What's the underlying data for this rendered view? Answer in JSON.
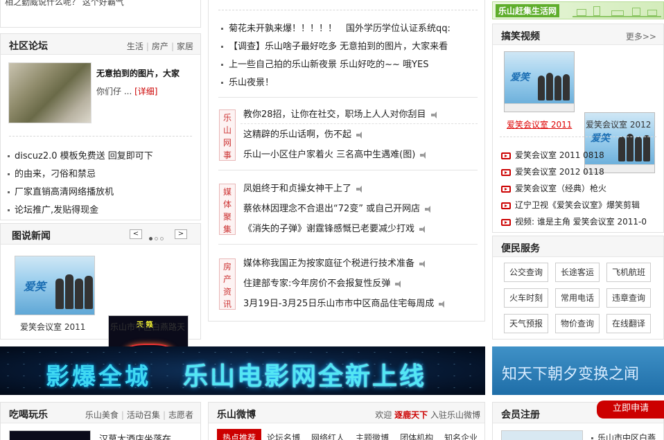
{
  "top_left_snippet": "相之勤威说什么呢？ 这个好霸气",
  "community": {
    "title": "社区论坛",
    "tabs": [
      "生活",
      "房产",
      "家居"
    ],
    "feature_title": "无意拍到的图片，大家",
    "feature_desc": "你们仔 ...",
    "feature_more": "[详细]",
    "items": [
      "discuz2.0 模板免费送 回复即可下",
      "的由来，刁俗和禁忌",
      "厂家直销高清网络播放机",
      "论坛推广,发贴得现金"
    ]
  },
  "photo_news": {
    "title": "图说新闻",
    "prev": "<",
    "next": ">",
    "photos": [
      {
        "caption": "爱笑会议室 2011"
      },
      {
        "caption": "乐山市中区白燕路天"
      }
    ]
  },
  "middle": {
    "top_lines": [
      "菊花未开孰来爆！！！！！　国外学历学位认证系统qq:",
      "【调查】乐山啥子最好吃多 无意拍到的图片，大家来看",
      "上一些自己拍的乐山新夜景 乐山好吃的~~ 哦YES",
      "乐山夜景！"
    ],
    "sections": [
      {
        "tag": "乐山网事",
        "lines": [
          "教你28招，让你在社交，职场上人人对你刮目",
          "这精辟的乐山话啊，伤不起",
          "乐山一小区住户家着火 三名高中生遇难(图)"
        ]
      },
      {
        "tag": "媒体聚集",
        "lines": [
          "凤姐终于和贞操女神干上了",
          "蔡依林因理念不合退出“72变” 或自己开网店",
          "《消失的子弹》谢霆锋感慨已老要减少打戏"
        ]
      },
      {
        "tag": "房产资讯",
        "lines": [
          "媒体称我国正为按家庭征个税进行技术准备",
          "住建部专家:今年房价不会报复性反弹",
          "3月19日-3月25日乐山市市中区商品住宅每周成"
        ]
      }
    ]
  },
  "right_top_banner": "乐山赶集生活网",
  "funny_video": {
    "title": "搞笑视频",
    "more": "更多>>",
    "thumbs": [
      {
        "caption": "爱笑会议室 2011"
      },
      {
        "caption": "爱笑会议室 2012"
      }
    ],
    "items": [
      "爱笑会议室 2011 0818",
      "爱笑会议室 2012 0118",
      "爱笑会议室（经典）枪火",
      "辽宁卫视《爱笑会议室》爆笑剪辑",
      "视频: 谁是主角 爱笑会议室 2011-0"
    ]
  },
  "services": {
    "title": "便民服务",
    "buttons": [
      "公交查询",
      "长途客运",
      "飞机航班",
      "火车时刻",
      "常用电话",
      "违章查询",
      "天气预报",
      "物价查询",
      "在线翻译"
    ]
  },
  "banner_main": {
    "left": "影爆全城",
    "right": "乐山电影网全新上线"
  },
  "banner_side": "知天下朝夕变换之闻",
  "food": {
    "title": "吃喝玩乐",
    "tabs": [
      "乐山美食",
      "活动召集",
      "志愿者"
    ],
    "first_item": "汉莫大酒店坐落在"
  },
  "weibo": {
    "title": "乐山微博",
    "welcome": "欢迎",
    "user": "逐鹿天下",
    "join": "入驻乐山微博",
    "tabs": [
      "热点推荐",
      "论坛名博",
      "网络红人",
      "主题微博",
      "团体机构",
      "知名企业"
    ]
  },
  "member": {
    "title": "会员注册",
    "apply": "立即申请",
    "item": "乐山市中区白燕"
  },
  "colors": {
    "accent_red": "#c00",
    "link_red": "#d00",
    "green": "#5fae2c"
  }
}
